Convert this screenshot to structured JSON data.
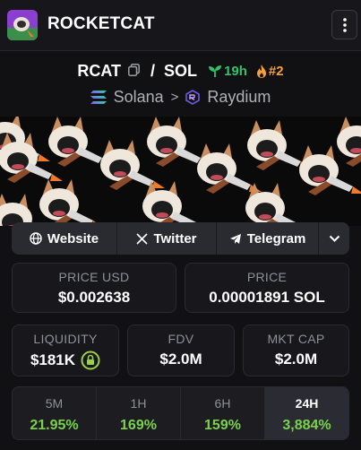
{
  "header": {
    "title": "ROCKETCAT"
  },
  "pair": {
    "base": "RCAT",
    "separator": "/",
    "quote": "SOL",
    "age": "19h",
    "rank": "#2"
  },
  "chain": {
    "network": "Solana",
    "arrow": ">",
    "dex": "Raydium"
  },
  "links": [
    {
      "label": "Website",
      "icon": "globe-icon"
    },
    {
      "label": "Twitter",
      "icon": "x-icon"
    },
    {
      "label": "Telegram",
      "icon": "telegram-icon"
    }
  ],
  "stats": {
    "price_usd": {
      "label": "PRICE USD",
      "value": "$0.002638"
    },
    "price_native": {
      "label": "PRICE",
      "value": "0.00001891 SOL"
    },
    "liquidity": {
      "label": "LIQUIDITY",
      "value": "$181K"
    },
    "fdv": {
      "label": "FDV",
      "value": "$2.0M"
    },
    "mkt_cap": {
      "label": "MKT CAP",
      "value": "$2.0M"
    }
  },
  "timeframes": [
    {
      "label": "5M",
      "value": "21.95%"
    },
    {
      "label": "1H",
      "value": "169%"
    },
    {
      "label": "6H",
      "value": "159%"
    },
    {
      "label": "24H",
      "value": "3,884%",
      "active": true
    }
  ],
  "colors": {
    "up": "#79d34a",
    "age": "#33c36b",
    "rank": "#f5a13b",
    "lock": "#9bd04a"
  }
}
